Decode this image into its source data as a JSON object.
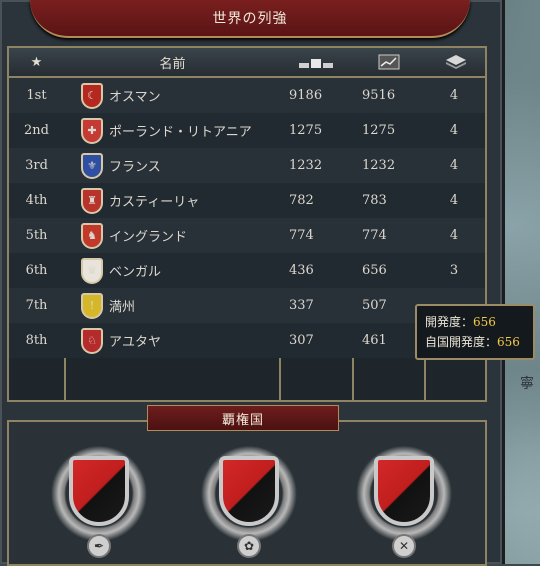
{
  "panel": {
    "title": "世界の列強"
  },
  "table": {
    "headers": {
      "rank_icon": "star-icon",
      "name": "名前",
      "col1_icon": "development-bars-icon",
      "col2_icon": "trend-graph-icon",
      "col3_icon": "layers-icon"
    },
    "rows": [
      {
        "rank": "1st",
        "name": "オスマン",
        "v1": "9186",
        "v2": "9516",
        "v3": "4",
        "color": "#b4281f",
        "symbol": "☾"
      },
      {
        "rank": "2nd",
        "name": "ポーランド・リトアニア",
        "v1": "1275",
        "v2": "1275",
        "v3": "4",
        "color": "#c63a35",
        "symbol": "✚"
      },
      {
        "rank": "3rd",
        "name": "フランス",
        "v1": "1232",
        "v2": "1232",
        "v3": "4",
        "color": "#2f4fa3",
        "symbol": "⚜"
      },
      {
        "rank": "4th",
        "name": "カスティーリャ",
        "v1": "782",
        "v2": "783",
        "v3": "4",
        "color": "#b8332b",
        "symbol": "♜"
      },
      {
        "rank": "5th",
        "name": "イングランド",
        "v1": "774",
        "v2": "774",
        "v3": "4",
        "color": "#c0392b",
        "symbol": "♞"
      },
      {
        "rank": "6th",
        "name": "ベンガル",
        "v1": "436",
        "v2": "656",
        "v3": "3",
        "color": "#e8e4dc",
        "symbol": "♛"
      },
      {
        "rank": "7th",
        "name": "満州",
        "v1": "337",
        "v2": "507",
        "v3": "",
        "color": "#d7b72a",
        "symbol": "!"
      },
      {
        "rank": "8th",
        "name": "アユタヤ",
        "v1": "307",
        "v2": "461",
        "v3": "",
        "color": "#b52a2a",
        "symbol": "♘"
      }
    ]
  },
  "tooltip": {
    "line1_label": "開発度：",
    "line1_value": "656",
    "line2_label": "自国開発度：",
    "line2_value": "656"
  },
  "hegemon": {
    "title": "覇権国"
  },
  "map": {
    "text": "寧"
  },
  "colors": {
    "banner_red": "#7a1f1f",
    "frame_gold": "#8e8464",
    "tooltip_value": "#f2c74a"
  }
}
